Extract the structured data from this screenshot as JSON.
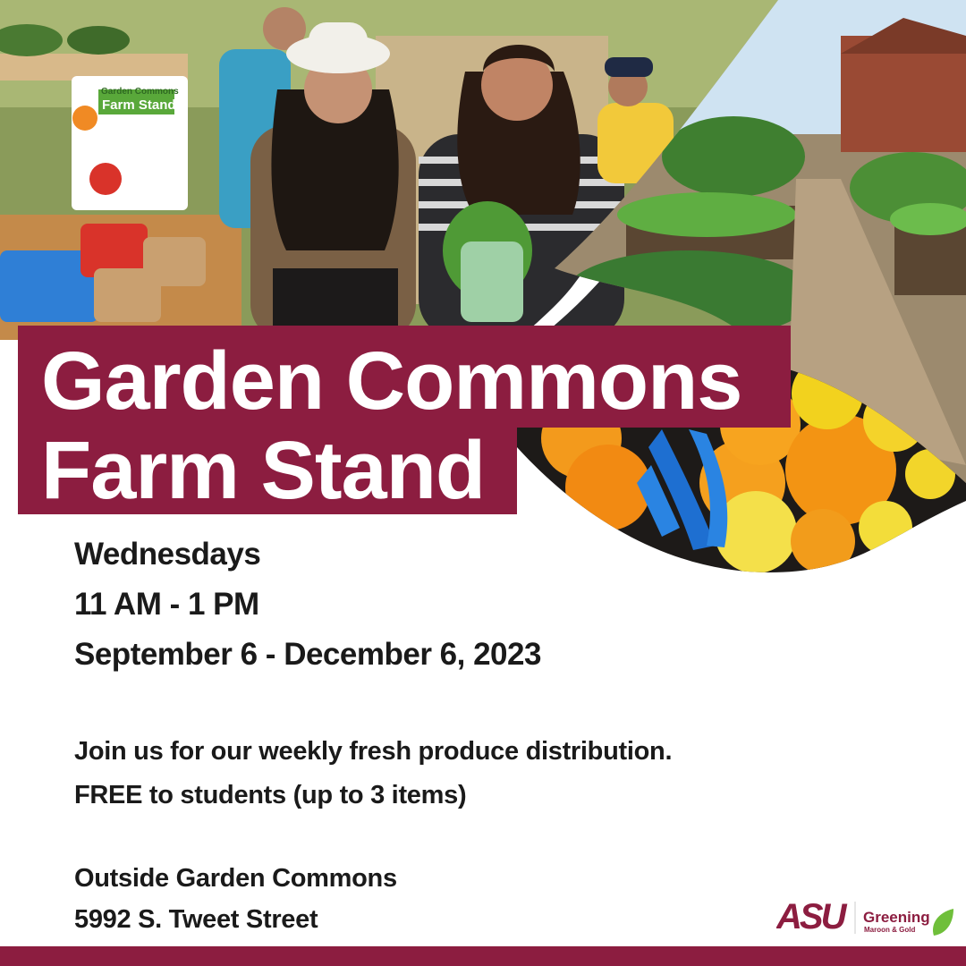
{
  "title": {
    "line1": "Garden Commons",
    "line2": "Farm Stand"
  },
  "schedule": {
    "day": "Wednesdays",
    "time": "11 AM - 1 PM",
    "dates": "September 6 - December 6, 2023"
  },
  "description": {
    "line1": "Join us for our weekly fresh produce distribution.",
    "line2": "FREE to students (up to 3 items)"
  },
  "location": {
    "name": "Outside Garden Commons",
    "address": "5992 S. Tweet Street"
  },
  "sign": {
    "small_heading": "Garden Commons",
    "heading": "Farm Stand"
  },
  "logos": {
    "asu": "ASU",
    "greening_main": "Greening",
    "greening_sub": "Maroon & Gold"
  },
  "colors": {
    "maroon": "#8c1d40",
    "gold": "#ffc627",
    "text": "#1a1a1a",
    "leaf_green": "#6fbf3a"
  }
}
